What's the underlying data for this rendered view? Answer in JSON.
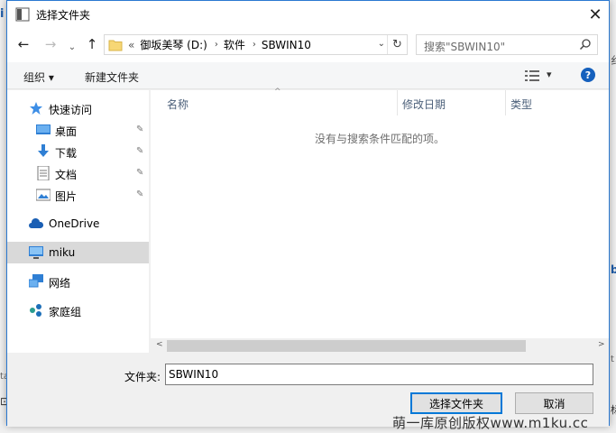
{
  "background_peek": {
    "left_top": "ia",
    "left_bottom": "al",
    "right_mid": "纟",
    "right_lower": "tif",
    "right_bottom": "标"
  },
  "titlebar": {
    "title": "选择文件夹",
    "close": "✕"
  },
  "nav": {
    "back": "←",
    "forward": "→",
    "dropdown": "⌄",
    "up": "↑",
    "breadcrumb": [
      "御坂美琴 (D:)",
      "软件",
      "SBWIN10"
    ],
    "overflow": "«",
    "refresh": "↻",
    "search_placeholder": "搜索\"SBWIN10\""
  },
  "toolbar": {
    "organize": "组织 ▾",
    "new_folder": "新建文件夹",
    "view_arrow": "▾",
    "help": "?"
  },
  "sidebar": {
    "items": [
      {
        "label": "快速访问",
        "icon": "star-icon"
      },
      {
        "label": "桌面",
        "icon": "desktop-icon",
        "pinned": true
      },
      {
        "label": "下载",
        "icon": "download-icon",
        "pinned": true
      },
      {
        "label": "文档",
        "icon": "document-icon",
        "pinned": true
      },
      {
        "label": "图片",
        "icon": "picture-icon",
        "pinned": true
      },
      {
        "label": "OneDrive",
        "icon": "cloud-icon"
      },
      {
        "label": "miku",
        "icon": "computer-icon",
        "selected": true
      },
      {
        "label": "网络",
        "icon": "network-icon"
      },
      {
        "label": "家庭组",
        "icon": "homegroup-icon"
      }
    ],
    "pin_glyph": "📌"
  },
  "content": {
    "columns": [
      "名称",
      "修改日期",
      "类型"
    ],
    "empty_message": "没有与搜索条件匹配的项。",
    "sort_glyph": "^",
    "scroll_left": "<",
    "scroll_right": ">"
  },
  "footer": {
    "folder_label": "文件夹:",
    "folder_value": "SBWIN10",
    "select_button": "选择文件夹",
    "cancel_button": "取消"
  },
  "watermark": "萌一库原创版权www.m1ku.cc",
  "colors": {
    "accent": "#0078d7",
    "folder": "#f7d775",
    "help": "#1560bd",
    "selected_row": "#d9d9d9"
  }
}
